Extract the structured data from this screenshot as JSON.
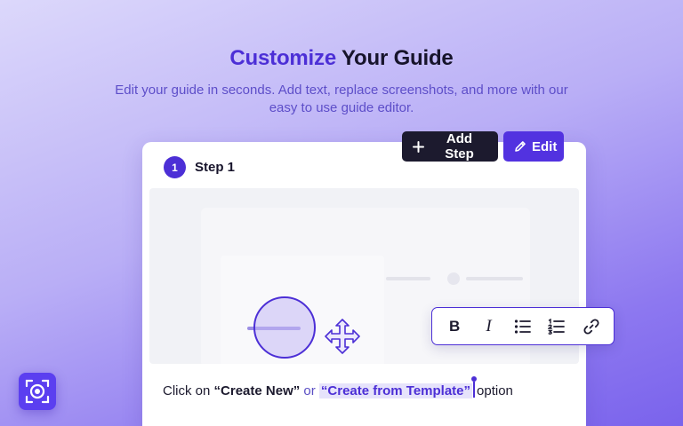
{
  "hero": {
    "title_accent": "Customize",
    "title_rest": " Your Guide",
    "subtitle": "Edit your guide in seconds. Add text, replace screenshots, and more with our easy to use guide editor."
  },
  "actions": {
    "add_step_label": "Add Step",
    "edit_label": "Edit",
    "add_step_icon": "plus-icon",
    "edit_icon": "pencil-icon"
  },
  "step": {
    "number": "1",
    "title": "Step 1"
  },
  "preview": {
    "overlay_icons": [
      "magnifier-circle",
      "move-arrows-icon"
    ]
  },
  "format_toolbar": {
    "bold": "B",
    "italic": "I",
    "bullet_list_icon": "bullet-list-icon",
    "numbered_list_icon": "numbered-list-icon",
    "link_icon": "link-icon"
  },
  "instruction": {
    "prefix": "Click on ",
    "option1": "“Create New”",
    "connector": " or ",
    "option2": "“Create from Template”",
    "suffix": "option"
  },
  "brand": {
    "logo_icon": "camera-focus-icon"
  },
  "colors": {
    "accent": "#4c2fd6",
    "dark_button": "#1c1a2e",
    "edit_button": "#5232e0"
  }
}
